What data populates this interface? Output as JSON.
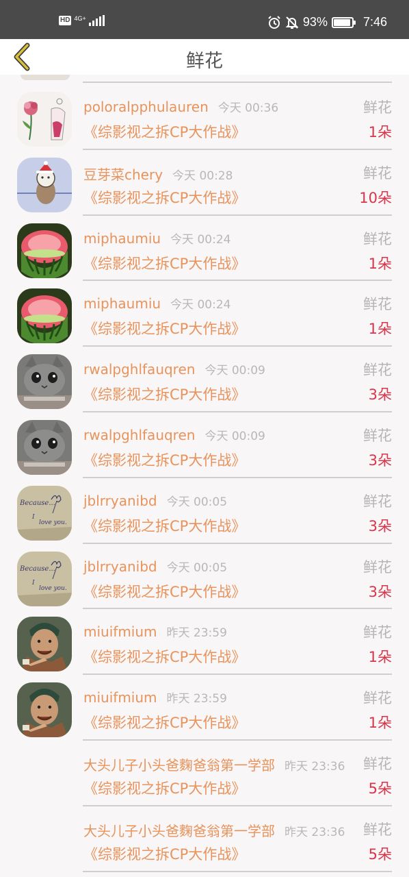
{
  "status_bar": {
    "hd": "HD",
    "network": "4G+",
    "battery_percent": "93%",
    "battery_level": 0.93,
    "time": "7:46",
    "icons": [
      "alarm-icon",
      "bell-off-icon"
    ]
  },
  "header": {
    "title": "鲜花",
    "back_icon": "chevron-left-icon"
  },
  "colors": {
    "accent": "#e8935c",
    "count": "#d9344a",
    "muted": "#b8b8b8",
    "back_arrow": "#d8bf3c"
  },
  "items": [
    {
      "name": "poloralpphulauren",
      "time": "今天 00:36",
      "gift": "鲜花",
      "book": "《综影视之拆CP大作战》",
      "count": "1朵",
      "avatar": "flower-drawing-avatar"
    },
    {
      "name": "豆芽菜chery",
      "time": "今天 00:28",
      "gift": "鲜花",
      "book": "《综影视之拆CP大作战》",
      "count": "10朵",
      "avatar": "cartoon-bear-avatar"
    },
    {
      "name": "miphaumiu",
      "time": "今天 00:24",
      "gift": "鲜花",
      "book": "《综影视之拆CP大作战》",
      "count": "1朵",
      "avatar": "watermelon-avatar"
    },
    {
      "name": "miphaumiu",
      "time": "今天 00:24",
      "gift": "鲜花",
      "book": "《综影视之拆CP大作战》",
      "count": "1朵",
      "avatar": "watermelon-avatar"
    },
    {
      "name": "rwalpghlfauqren",
      "time": "今天 00:09",
      "gift": "鲜花",
      "book": "《综影视之拆CP大作战》",
      "count": "3朵",
      "avatar": "cat-avatar"
    },
    {
      "name": "rwalpghlfauqren",
      "time": "今天 00:09",
      "gift": "鲜花",
      "book": "《综影视之拆CP大作战》",
      "count": "3朵",
      "avatar": "cat-avatar"
    },
    {
      "name": "jblrryanibd",
      "time": "今天 00:05",
      "gift": "鲜花",
      "book": "《综影视之拆CP大作战》",
      "count": "3朵",
      "avatar": "handwritten-note-avatar"
    },
    {
      "name": "jblrryanibd",
      "time": "今天 00:05",
      "gift": "鲜花",
      "book": "《综影视之拆CP大作战》",
      "count": "3朵",
      "avatar": "handwritten-note-avatar"
    },
    {
      "name": "miuifmium",
      "time": "昨天 23:59",
      "gift": "鲜花",
      "book": "《综影视之拆CP大作战》",
      "count": "1朵",
      "avatar": "pointing-man-avatar"
    },
    {
      "name": "miuifmium",
      "time": "昨天 23:59",
      "gift": "鲜花",
      "book": "《综影视之拆CP大作战》",
      "count": "1朵",
      "avatar": "pointing-man-avatar"
    },
    {
      "name": "大头儿子小头爸麴爸翁第一学部",
      "time": "昨天 23:36",
      "gift": "鲜花",
      "book": "《综影视之拆CP大作战》",
      "count": "5朵",
      "avatar": ""
    },
    {
      "name": "大头儿子小头爸麴爸翁第一学部",
      "time": "昨天 23:36",
      "gift": "鲜花",
      "book": "《综影视之拆CP大作战》",
      "count": "5朵",
      "avatar": ""
    }
  ]
}
